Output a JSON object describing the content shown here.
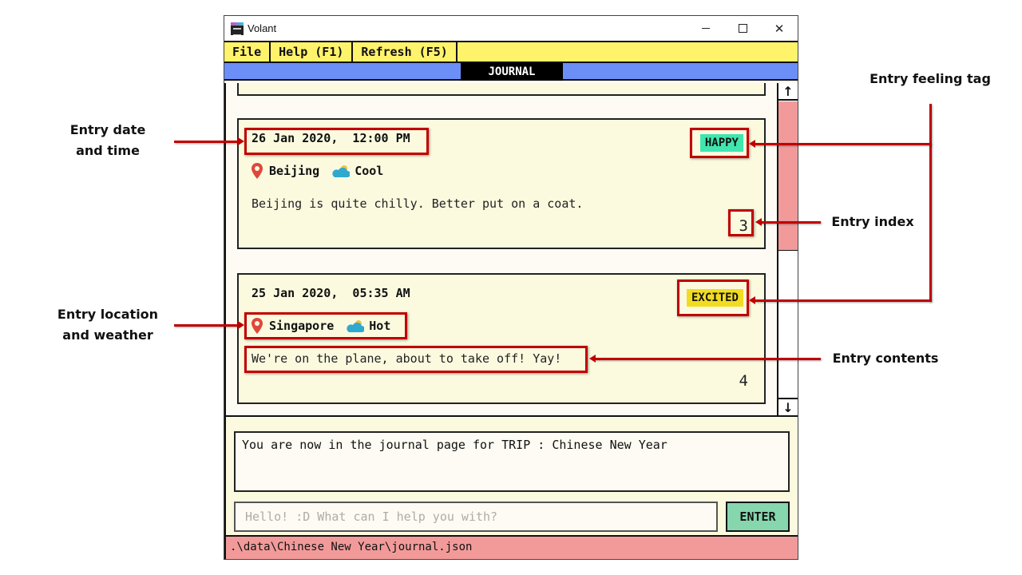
{
  "window": {
    "title": "Volant",
    "controls": {
      "minimize": "minimize",
      "maximize": "maximize",
      "close": "✕"
    }
  },
  "menu": {
    "items": [
      {
        "label": "File"
      },
      {
        "label": "Help (F1)"
      },
      {
        "label": "Refresh (F5)"
      }
    ]
  },
  "tab": {
    "active": "JOURNAL"
  },
  "entries": [
    {
      "datetime": "26 Jan 2020,  12:00 PM",
      "location": "Beijing",
      "weather": "Cool",
      "content": "Beijing is quite chilly. Better put on a coat.",
      "feeling": "HAPPY",
      "feeling_color": "#3fe6ae",
      "index": "3"
    },
    {
      "datetime": "25 Jan 2020,  05:35 AM",
      "location": "Singapore",
      "weather": "Hot",
      "content": "We're on the plane, about to take off! Yay!",
      "feeling": "EXCITED",
      "feeling_color": "#f2dc22",
      "index": "4"
    }
  ],
  "scrollbar": {
    "up": "↑",
    "down": "↓",
    "position_fraction": 0.0,
    "thumb_fraction": 0.47
  },
  "result": {
    "text": "You are now in the journal page for TRIP : Chinese New Year"
  },
  "command": {
    "value": "",
    "placeholder": "Hello! :D What can I help you with?",
    "enter_label": "ENTER"
  },
  "status": {
    "path": ".\\data\\Chinese New Year\\journal.json"
  },
  "annotations": {
    "date_time": "Entry date\nand time",
    "location_weather": "Entry location\nand weather",
    "feeling_tag": "Entry feeling tag",
    "index": "Entry index",
    "contents": "Entry contents"
  },
  "colors": {
    "menu_bg": "#fff36b",
    "tab_bg": "#6b8ff7",
    "card_bg": "#fbfadf",
    "status_bg": "#f29a9a",
    "enter_bg": "#86d6ae",
    "annotation": "#c00000"
  }
}
